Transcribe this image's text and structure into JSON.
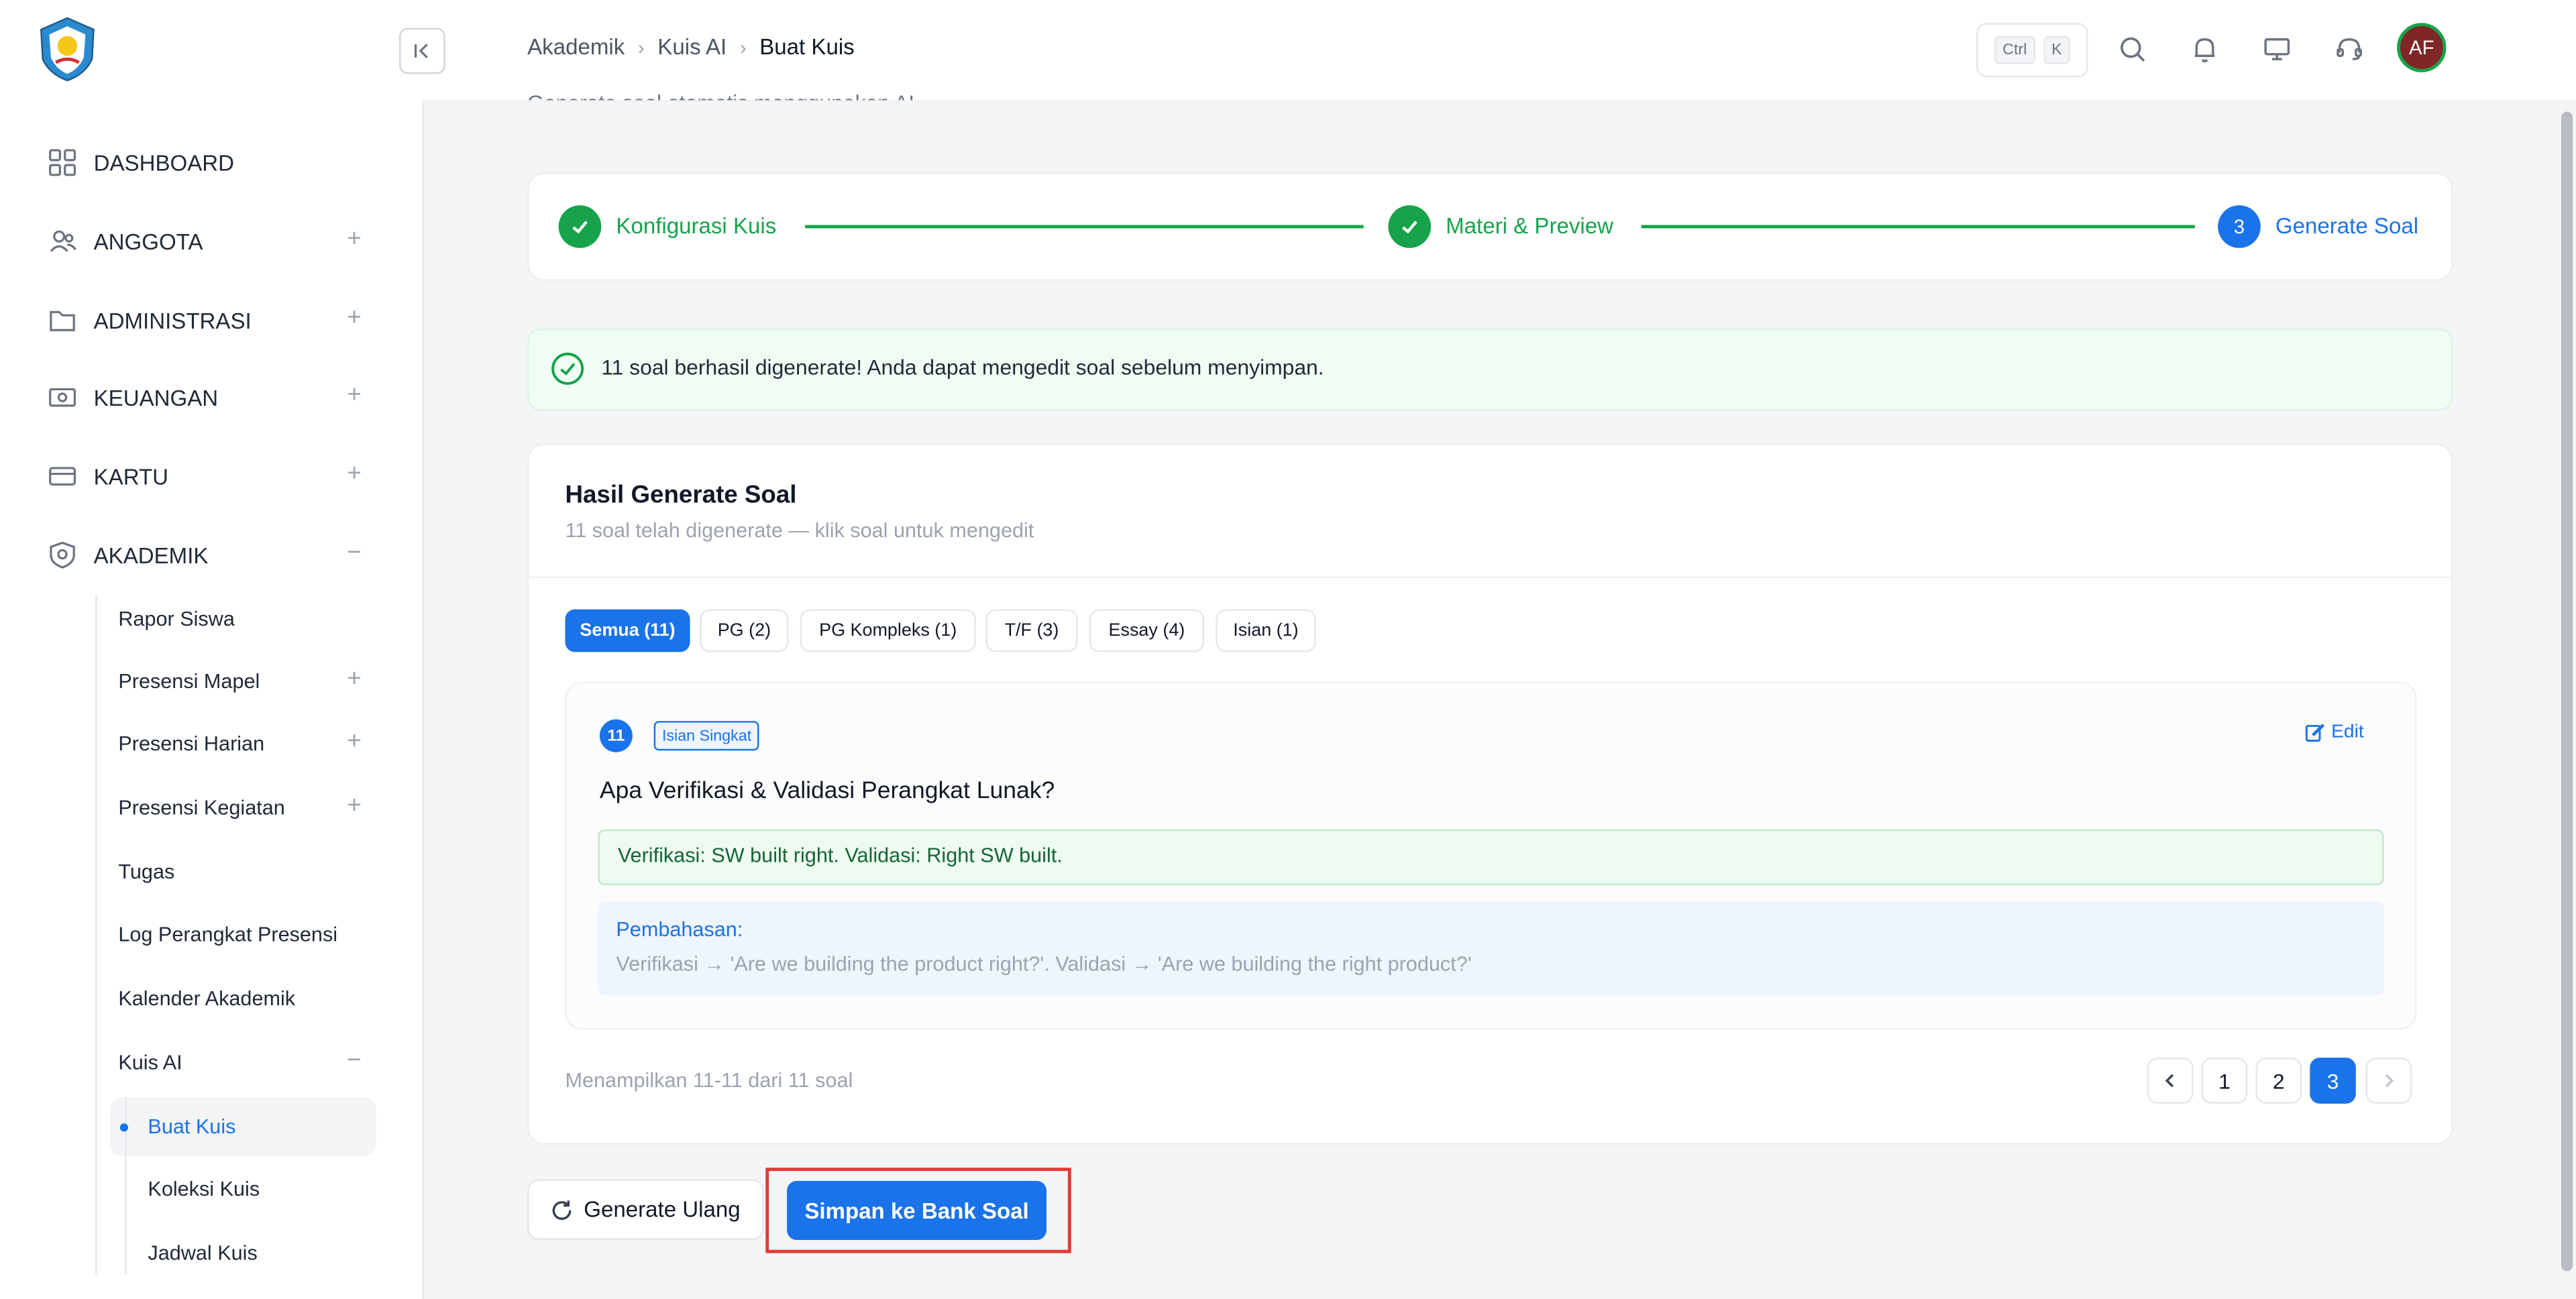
{
  "sidebar": {
    "nav": [
      {
        "label": "DASHBOARD"
      },
      {
        "label": "ANGGOTA"
      },
      {
        "label": "ADMINISTRASI"
      },
      {
        "label": "KEUANGAN"
      },
      {
        "label": "KARTU"
      },
      {
        "label": "AKADEMIK"
      }
    ],
    "akademik_items": [
      {
        "label": "Rapor Siswa"
      },
      {
        "label": "Presensi Mapel"
      },
      {
        "label": "Presensi Harian"
      },
      {
        "label": "Presensi Kegiatan"
      },
      {
        "label": "Tugas"
      },
      {
        "label": "Log Perangkat Presensi"
      },
      {
        "label": "Kalender Akademik"
      },
      {
        "label": "Kuis AI"
      }
    ],
    "kuis_items": [
      {
        "label": "Buat Kuis"
      },
      {
        "label": "Koleksi Kuis"
      },
      {
        "label": "Jadwal Kuis"
      }
    ]
  },
  "header": {
    "breadcrumb": [
      "Akademik",
      "Kuis AI",
      "Buat Kuis"
    ],
    "shortcut_keys": [
      "Ctrl",
      "K"
    ],
    "avatar_initials": "AF"
  },
  "page": {
    "subtitle_clipped": "Generate soal otomatis menggunakan AI"
  },
  "stepper": {
    "steps": [
      {
        "label": "Konfigurasi Kuis",
        "status": "done"
      },
      {
        "label": "Materi & Preview",
        "status": "done"
      },
      {
        "label": "Generate Soal",
        "status": "active",
        "number": "3"
      }
    ]
  },
  "alert": {
    "text": "11 soal berhasil digenerate! Anda dapat mengedit soal sebelum menyimpan."
  },
  "result": {
    "title": "Hasil Generate Soal",
    "subtitle": "11 soal telah digenerate — klik soal untuk mengedit",
    "tabs": [
      {
        "label": "Semua (11)",
        "active": true
      },
      {
        "label": "PG (2)"
      },
      {
        "label": "PG Kompleks (1)"
      },
      {
        "label": "T/F (3)"
      },
      {
        "label": "Essay (4)"
      },
      {
        "label": "Isian (1)"
      }
    ],
    "question": {
      "number": "11",
      "type": "Isian Singkat",
      "edit_label": "Edit",
      "text": "Apa Verifikasi & Validasi Perangkat Lunak?",
      "answer": "Verifikasi: SW built right. Validasi: Right SW built.",
      "explanation_label": "Pembahasan:",
      "explanation": "Verifikasi → 'Are we building the product right?'. Validasi → 'Are we building the right product?'"
    },
    "showing": "Menampilkan 11-11 dari 11 soal",
    "pages": [
      "1",
      "2",
      "3"
    ],
    "current_page": "3"
  },
  "actions": {
    "regenerate": "Generate Ulang",
    "save": "Simpan ke Bank Soal"
  },
  "colors": {
    "primary": "#1a73e8",
    "success": "#16a34a",
    "highlight": "#e53935"
  }
}
